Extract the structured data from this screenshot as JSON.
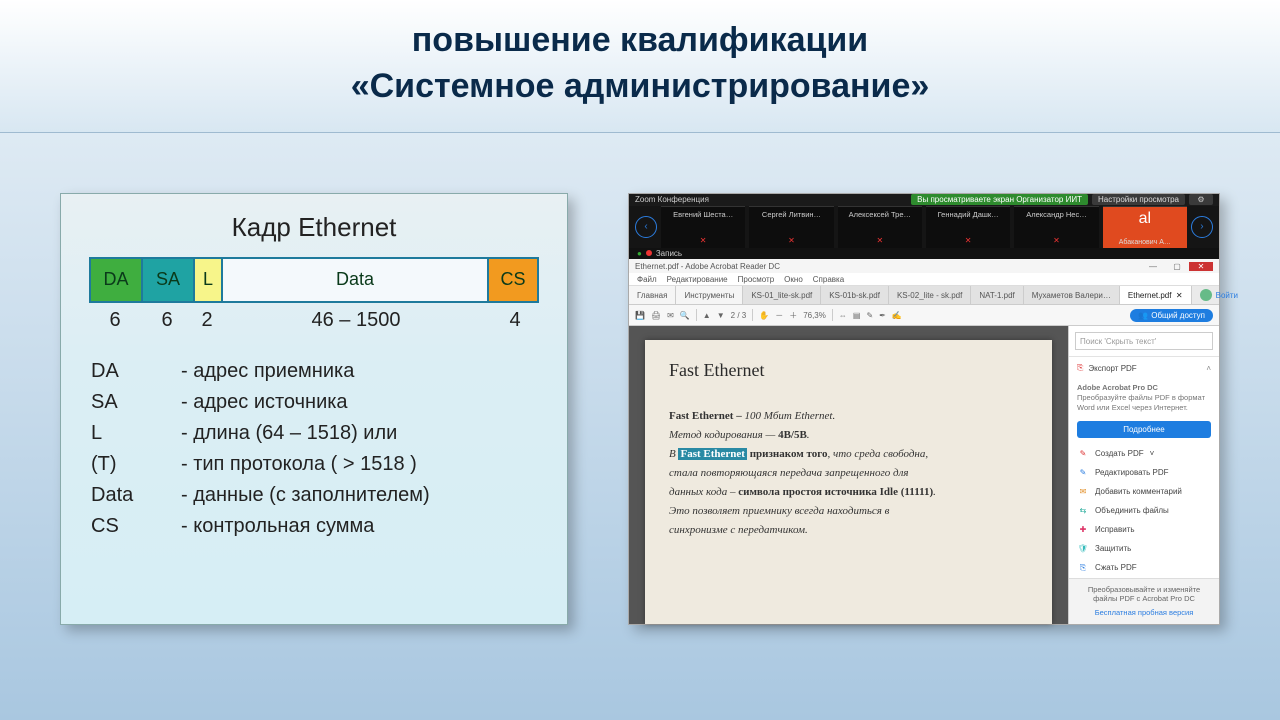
{
  "header": {
    "line1": "повышение квалификации",
    "line2": "«Системное администрирование»"
  },
  "left": {
    "title": "Кадр Ethernet",
    "frame": {
      "da": "DA",
      "sa": "SA",
      "l": "L",
      "data": "Data",
      "cs": "CS"
    },
    "sizes": {
      "da": "6",
      "sa": "6",
      "l": "2",
      "data": "46 – 1500",
      "cs": "4"
    },
    "legend": [
      {
        "k": "DA",
        "v": "- адрес приемника"
      },
      {
        "k": "SA",
        "v": "- адрес источника"
      },
      {
        "k": "L",
        "v": "- длина (64 – 1518) или"
      },
      {
        "k": "(T)",
        "v": "- тип протокола ( > 1518 )"
      },
      {
        "k": "Data",
        "v": "- данные (с заполнителем)"
      },
      {
        "k": "CS",
        "v": "- контрольная сумма"
      }
    ]
  },
  "zoom": {
    "title": "Zoom Конференция",
    "banner": "Вы просматриваете экран Организатор ИИТ",
    "viewopts": "Настройки просмотра",
    "participants": [
      "Евгений Шеста…",
      "Сергей Литвин…",
      "Алексексей Тре…",
      "Геннадий Дашк…",
      "Александр Нес…",
      "al"
    ],
    "sub": "Абаканович А…",
    "rec": "Запись"
  },
  "acrobat": {
    "title": "Ethernet.pdf - Adobe Acrobat Reader DC",
    "menu": [
      "Файл",
      "Редактирование",
      "Просмотр",
      "Окно",
      "Справка"
    ],
    "tabs": {
      "home": "Главная",
      "tools": "Инструменты",
      "files": [
        "KS-01_lite-sk.pdf",
        "KS-01b-sk.pdf",
        "KS-02_lite - sk.pdf",
        "NAT-1.pdf",
        "Мухаметов Валери…",
        "Ethernet.pdf"
      ],
      "signin": "Войти"
    },
    "toolbar": {
      "page_of": "2 / 3",
      "zoom": "76,3%",
      "share": "Общий доступ"
    },
    "doc": {
      "h": "Fast Ethernet",
      "p1a": "Fast Ethernet – ",
      "p1b": "100 Мбит Ethernet.",
      "p2a": "Метод кодирования — ",
      "p2b": "4B/5B",
      "p2c": ".",
      "p3a": "В ",
      "p3hl": "Fast Ethernet",
      "p3b": " признаком того",
      "p3c": ", что среда свободна,",
      "p4": "стала повторяющаяся передача запрещенного для",
      "p5a": "данных кода – ",
      "p5b": "символа простоя источника Idle (11111)",
      "p5c": ".",
      "p6": "Это позволяет приемнику всегда находиться в",
      "p7": "синхронизме с передатчиком."
    },
    "side": {
      "search": "Поиск 'Скрыть текст'",
      "export": "Экспорт PDF",
      "promo_h": "Adobe Acrobat Pro DC",
      "promo": "Преобразуйте файлы PDF в формат Word или Excel через Интернет.",
      "cta": "Подробнее",
      "items": [
        {
          "icon": "ic-red",
          "glyph": "✎",
          "label": "Создать PDF"
        },
        {
          "icon": "ic-blue",
          "glyph": "✎",
          "label": "Редактировать PDF"
        },
        {
          "icon": "ic-orange",
          "glyph": "✉",
          "label": "Добавить комментарий"
        },
        {
          "icon": "ic-teal",
          "glyph": "⇆",
          "label": "Объединить файлы"
        },
        {
          "icon": "ic-pink",
          "glyph": "✚",
          "label": "Исправить"
        },
        {
          "icon": "ic-cyan",
          "glyph": "🛡",
          "label": "Защитить"
        },
        {
          "icon": "ic-blue",
          "glyph": "⎘",
          "label": "Сжать PDF"
        }
      ],
      "foot1": "Преобразовывайте и изменяйте файлы PDF с Acrobat Pro DC",
      "foot2": "Бесплатная пробная версия"
    }
  }
}
